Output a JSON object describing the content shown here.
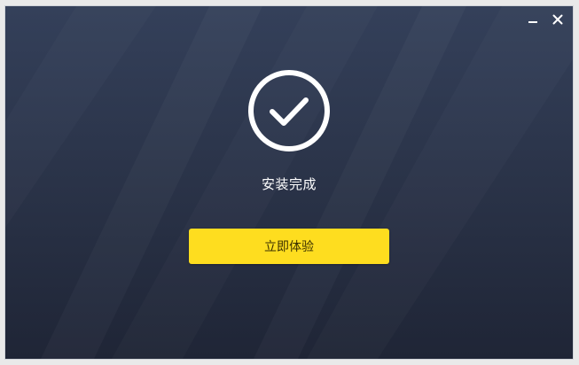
{
  "window": {
    "minimize_icon": "minimize-icon",
    "close_icon": "close-icon"
  },
  "status": {
    "icon": "check-circle-icon",
    "text": "安装完成"
  },
  "action": {
    "label": "立即体验"
  },
  "colors": {
    "accent": "#fedd1f",
    "background_top": "#34405a",
    "background_bottom": "#1f2536",
    "text": "#ffffff"
  }
}
